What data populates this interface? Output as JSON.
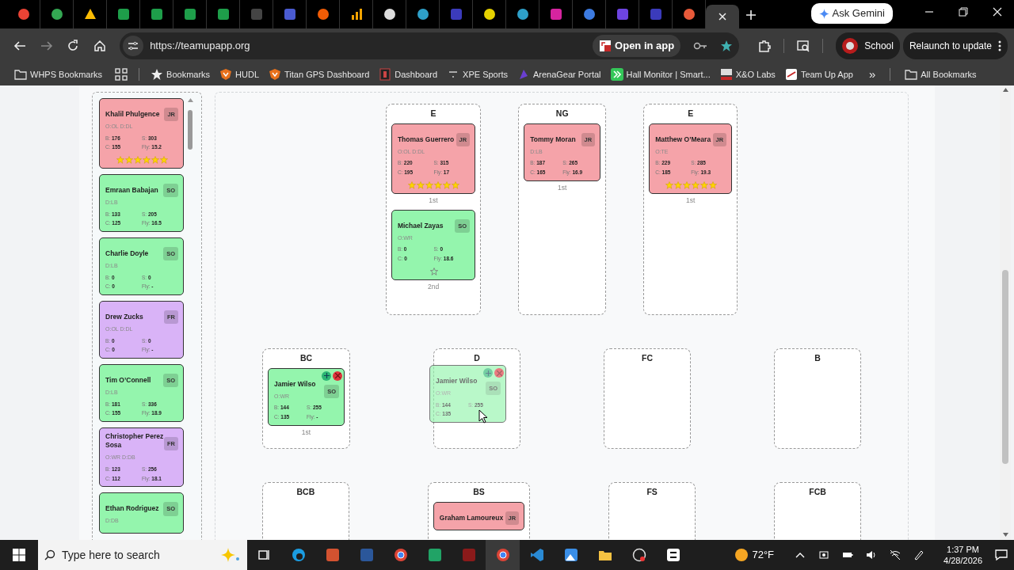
{
  "browser": {
    "tabs": [
      {
        "selected": false
      },
      {
        "selected": false
      },
      {
        "selected": false
      },
      {
        "selected": false
      },
      {
        "selected": false
      },
      {
        "selected": false
      },
      {
        "selected": false
      },
      {
        "selected": false
      },
      {
        "selected": false
      },
      {
        "selected": false
      },
      {
        "selected": false
      },
      {
        "selected": false
      },
      {
        "selected": false
      },
      {
        "selected": false
      },
      {
        "selected": false
      },
      {
        "selected": false
      },
      {
        "selected": false
      },
      {
        "selected": false
      },
      {
        "selected": false
      },
      {
        "selected": false
      },
      {
        "selected": false
      },
      {
        "selected": true
      }
    ],
    "ask_button": "Ask Gemini",
    "address": "https://teamupapp.org",
    "open_in_app": "Open in app",
    "profile": "School",
    "relaunch": "Relaunch to update",
    "bookmarks": [
      {
        "label": "WHPS Bookmarks",
        "kind": "folder"
      },
      {
        "kind": "apps"
      },
      {
        "label": "Bookmarks",
        "kind": "star"
      },
      {
        "label": "HUDL",
        "kind": "shield"
      },
      {
        "label": "Titan GPS Dashboard",
        "kind": "shield"
      },
      {
        "label": "Dashboard",
        "kind": "badge"
      },
      {
        "label": "XPE Sports",
        "kind": "dash"
      },
      {
        "label": "ArenaGear Portal",
        "kind": "flag"
      },
      {
        "label": "Hall Monitor | Smart...",
        "kind": "chevrons"
      },
      {
        "label": "X&O Labs",
        "kind": "xo"
      },
      {
        "label": "Team Up App",
        "kind": "app"
      }
    ],
    "more_bookmarks": "»",
    "all_bookmarks": "All Bookmarks"
  },
  "roster": [
    {
      "name": "Khalil Phulgence",
      "positions": "O:OL D:DL",
      "grade": "JR",
      "color": "#f5a3a9",
      "stats": [
        "B: **176**",
        "S: **303**",
        "C: **155**",
        "Fly: **15.2**"
      ],
      "stars": 6
    },
    {
      "name": "Emraan Babajan",
      "positions": "D:LB",
      "grade": "SO",
      "color": "#94f5ad",
      "stats": [
        "B: **133**",
        "S: **205**",
        "C: **125**",
        "Fly: **16.5**"
      ]
    },
    {
      "name": "Charlie Doyle",
      "positions": "D:LB",
      "grade": "SO",
      "color": "#94f5ad",
      "stats": [
        "B: **0**",
        "S: **0**",
        "C: **0**",
        "Fly: **-**"
      ]
    },
    {
      "name": "Drew Zucks",
      "positions": "O:OL D:DL",
      "grade": "FR",
      "color": "#d9b3f7",
      "stats": [
        "B: **0**",
        "S: **0**",
        "C: **0**",
        "Fly: **-**"
      ]
    },
    {
      "name": "Tim O’Connell",
      "positions": "D:LB",
      "grade": "SO",
      "color": "#94f5ad",
      "stats": [
        "B: **181**",
        "S: **336**",
        "C: **155**",
        "Fly: **18.9**"
      ]
    },
    {
      "name": "Christopher Perez Sosa",
      "positions": "O:WR D:DB",
      "grade": "FR",
      "color": "#d9b3f7",
      "stats": [
        "B: **123**",
        "S: **256**",
        "C: **112**",
        "Fly: **18.1**"
      ]
    },
    {
      "name": "Ethan Rodriguez",
      "positions": "D:DB",
      "grade": "SO",
      "color": "#94f5ad"
    }
  ],
  "depth_chart": {
    "rows": [
      [
        {
          "label": "E",
          "players": [
            {
              "name": "Thomas Guerrero",
              "positions": "O:OL D:DL",
              "grade": "JR",
              "color": "#f5a3a9",
              "stats": [
                "B: **220**",
                "S: **315**",
                "C: **195**",
                "Fly: **17**"
              ],
              "stars": 6,
              "depth": "1st"
            },
            {
              "name": "Michael Zayas",
              "positions": "O:WR",
              "grade": "SO",
              "color": "#94f5ad",
              "stats": [
                "B: **0**",
                "S: **0**",
                "C: **0**",
                "Fly: **18.6**"
              ],
              "starred": false,
              "depth": "2nd"
            }
          ]
        },
        {
          "label": "NG",
          "players": [
            {
              "name": "Tommy Moran",
              "positions": "D:LB",
              "grade": "JR",
              "color": "#f5a3a9",
              "stats": [
                "B: **187**",
                "S: **265**",
                "C: **165**",
                "Fly: **16.9**"
              ],
              "depth": "1st"
            }
          ]
        },
        {
          "label": "E",
          "players": [
            {
              "name": "Matthew O’Meara",
              "positions": "O:TE",
              "grade": "JR",
              "color": "#f5a3a9",
              "stats": [
                "B: **229**",
                "S: **285**",
                "C: **185**",
                "Fly: **19.3**"
              ],
              "stars": 6,
              "depth": "1st"
            }
          ]
        }
      ],
      [
        {
          "label": "BC",
          "players": [
            {
              "name": "Jamier Wilso",
              "positions": "O:WR",
              "grade": "SO",
              "color": "#94f5ad",
              "stats": [
                "B: **144**",
                "S: **255**",
                "C: **135**",
                "Fly: **-**"
              ],
              "hovered": true,
              "depth": "1st"
            }
          ]
        },
        {
          "label": "D",
          "drag_preview": {
            "name": "Jamier Wilso",
            "positions": "O:WR",
            "grade": "SO",
            "color": "#94f5ad",
            "stats": [
              "B: **144**",
              "S: **255**",
              "C: **135**"
            ],
            "hovered": true
          }
        },
        {
          "label": "FC"
        },
        {
          "label": "B"
        }
      ],
      [
        {
          "label": "BCB"
        },
        {
          "label": "BS",
          "players": [
            {
              "name": "Graham Lamoureux",
              "grade": "JR",
              "color": "#f5a3a9"
            }
          ]
        },
        {
          "label": "FS"
        },
        {
          "label": "FCB"
        }
      ]
    ]
  },
  "taskbar": {
    "search_placeholder": "Type here to search",
    "temperature": "72°F",
    "time": "1:37 PM",
    "date": "4/28/2026"
  }
}
